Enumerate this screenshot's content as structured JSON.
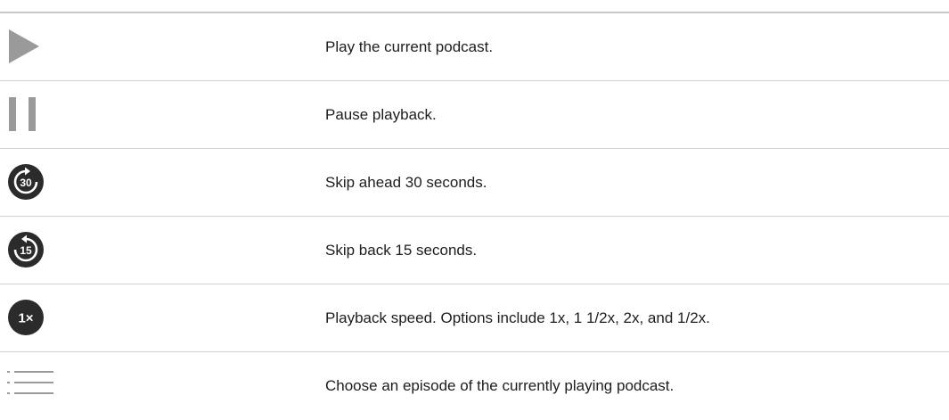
{
  "rows": [
    {
      "icon": "play-icon",
      "description": "Play the current podcast."
    },
    {
      "icon": "pause-icon",
      "description": "Pause playback."
    },
    {
      "icon": "skip-forward-30-icon",
      "label": "30",
      "description": "Skip ahead 30 seconds."
    },
    {
      "icon": "skip-back-15-icon",
      "label": "15",
      "description": "Skip back 15 seconds."
    },
    {
      "icon": "playback-speed-icon",
      "label": "1×",
      "description": "Playback speed. Options include 1x, 1 1/2x, 2x, and 1/2x."
    },
    {
      "icon": "episode-list-icon",
      "description": "Choose an episode of the currently playing podcast."
    }
  ],
  "colors": {
    "icon_gray": "#9a9a9a",
    "icon_dark": "#2b2b2b",
    "text": "#1d1d1f",
    "rule": "#d2d2d7"
  }
}
